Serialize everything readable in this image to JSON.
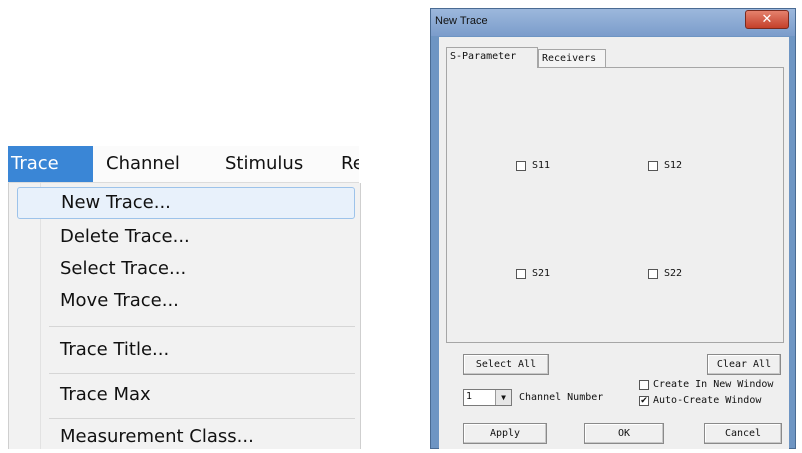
{
  "menubar": {
    "items": [
      "Trace",
      "Channel",
      "Stimulus",
      "Re"
    ]
  },
  "menu": {
    "items": [
      "New Trace...",
      "Delete Trace...",
      "Select Trace...",
      "Move Trace...",
      "Trace Title...",
      "Trace Max",
      "Measurement Class..."
    ]
  },
  "dialog": {
    "title": "New Trace",
    "close_icon": "close-icon",
    "tabs": [
      "S-Parameter",
      "Receivers"
    ],
    "checkboxes": {
      "s11": "S11",
      "s12": "S12",
      "s21": "S21",
      "s22": "S22"
    },
    "select_all": "Select All",
    "clear_all": "Clear All",
    "channel_value": "1",
    "channel_label": "Channel Number",
    "create_new_window": "Create In New Window",
    "auto_create_window": "Auto-Create Window",
    "apply": "Apply",
    "ok": "OK",
    "cancel": "Cancel"
  }
}
